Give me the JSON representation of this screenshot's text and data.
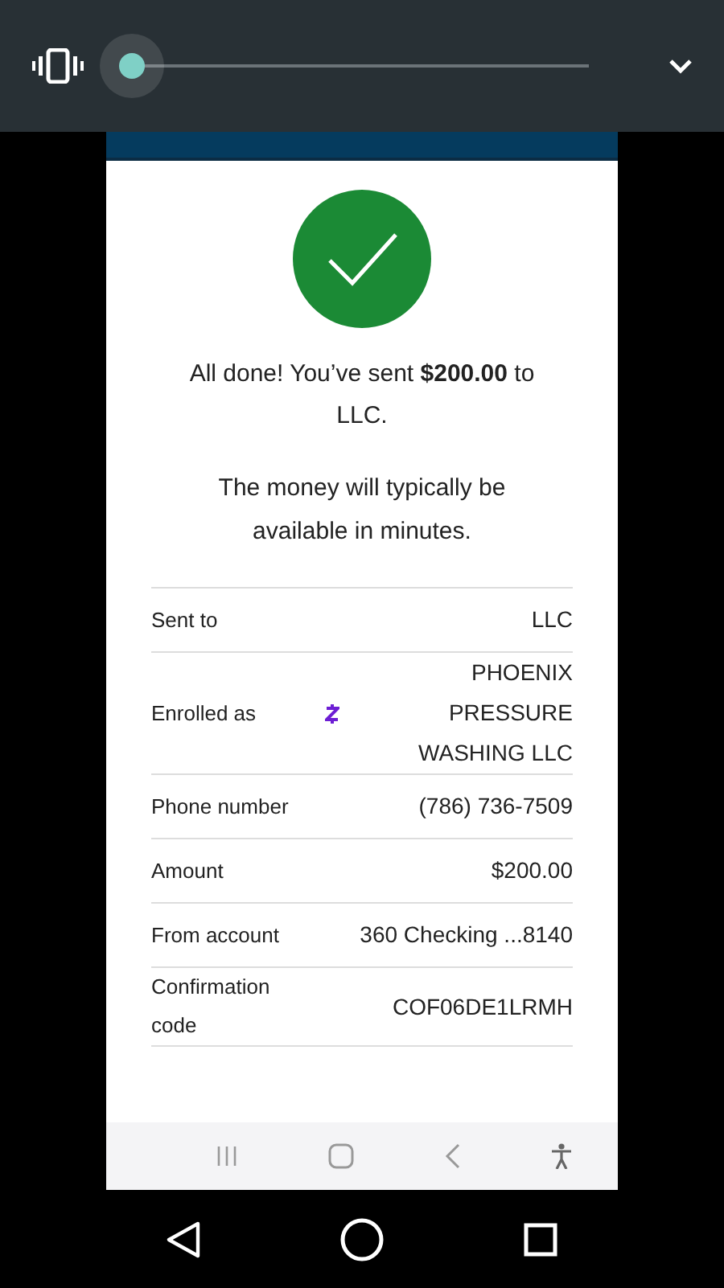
{
  "volume_panel": {
    "level": 0
  },
  "confirmation": {
    "message": "All done! You’ve sent **$200.00** to LLC.",
    "note": "The money will typically be available in minutes."
  },
  "details": [
    {
      "label": "Sent to",
      "value": "LLC",
      "kind": "plain"
    },
    {
      "label": "Enrolled as",
      "value": "PHOENIX PRESSURE WASHING LLC",
      "kind": "zelle"
    },
    {
      "label": "Phone number",
      "value": "(786) 736-7509",
      "kind": "plain"
    },
    {
      "label": "Amount",
      "value": "$200.00",
      "kind": "plain"
    },
    {
      "label": "From account",
      "value": "360 Checking ...8140",
      "kind": "plain"
    },
    {
      "label": "Confirmation code",
      "value": "COF06DE1LRMH",
      "kind": "plain"
    }
  ]
}
